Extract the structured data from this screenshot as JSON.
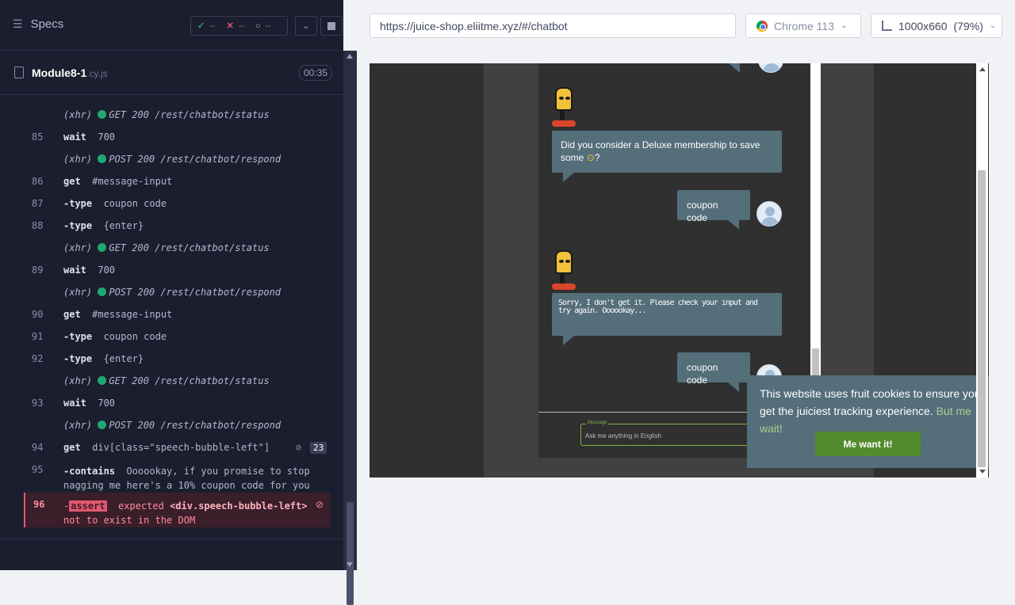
{
  "runner": {
    "specs_label": "Specs",
    "passed": "--",
    "failed": "--",
    "pending": "--",
    "file_name": "Module8-1",
    "file_ext": ".cy.js",
    "duration": "00:35"
  },
  "commands": [
    {
      "num": "",
      "type": "xhr",
      "text": "(xhr)",
      "detail": "GET 200 /rest/chatbot/status"
    },
    {
      "num": "85",
      "type": "cmd",
      "text": "wait",
      "detail": "700"
    },
    {
      "num": "",
      "type": "xhr",
      "text": "(xhr)",
      "detail": "POST 200 /rest/chatbot/respond"
    },
    {
      "num": "86",
      "type": "cmd",
      "text": "get",
      "detail": "#message-input"
    },
    {
      "num": "87",
      "type": "cmd",
      "text": "-type",
      "detail": "coupon code"
    },
    {
      "num": "88",
      "type": "cmd",
      "text": "-type",
      "detail": "{enter}"
    },
    {
      "num": "",
      "type": "xhr",
      "text": "(xhr)",
      "detail": "GET 200 /rest/chatbot/status"
    },
    {
      "num": "89",
      "type": "cmd",
      "text": "wait",
      "detail": "700"
    },
    {
      "num": "",
      "type": "xhr",
      "text": "(xhr)",
      "detail": "POST 200 /rest/chatbot/respond"
    },
    {
      "num": "90",
      "type": "cmd",
      "text": "get",
      "detail": "#message-input"
    },
    {
      "num": "91",
      "type": "cmd",
      "text": "-type",
      "detail": "coupon code"
    },
    {
      "num": "92",
      "type": "cmd",
      "text": "-type",
      "detail": "{enter}"
    },
    {
      "num": "",
      "type": "xhr",
      "text": "(xhr)",
      "detail": "GET 200 /rest/chatbot/status"
    },
    {
      "num": "93",
      "type": "cmd",
      "text": "wait",
      "detail": "700"
    },
    {
      "num": "",
      "type": "xhr",
      "text": "(xhr)",
      "detail": "POST 200 /rest/chatbot/respond"
    },
    {
      "num": "94",
      "type": "cmd",
      "text": "get",
      "detail": "div[class=\"speech-bubble-left\"]"
    }
  ],
  "count_badge": "23",
  "contains": {
    "num": "95",
    "cmd": "-contains",
    "line1": "Oooookay, if you promise to stop",
    "line2": "nagging me here's a 10% coupon code for you"
  },
  "assert": {
    "num": "96",
    "tag": "assert",
    "line1a": "expected",
    "line1b": "<div.speech-bubble-left>",
    "line2": "not to exist in the DOM"
  },
  "browser": {
    "url": "https://juice-shop.eliitme.xyz/#/chatbot",
    "name": "Chrome 113",
    "viewport": "1000x660",
    "zoom": "(79%)"
  },
  "chat": {
    "bot_msg_1": "Did you consider a Deluxe membership to save some",
    "bot_msg_1_tail": "?",
    "user_msg_1": "coupon code",
    "bot_msg_2_garbled": "Sorry, I don't get it. Please check your input and try again. Oooookay...",
    "user_msg_2": "coupon code",
    "input_label": "Message",
    "input_placeholder": "Ask me anything in English"
  },
  "cookie": {
    "message": "This website uses fruit cookies to ensure you get the juiciest tracking experience.",
    "link": "But me wait!",
    "button": "Me want it!"
  }
}
